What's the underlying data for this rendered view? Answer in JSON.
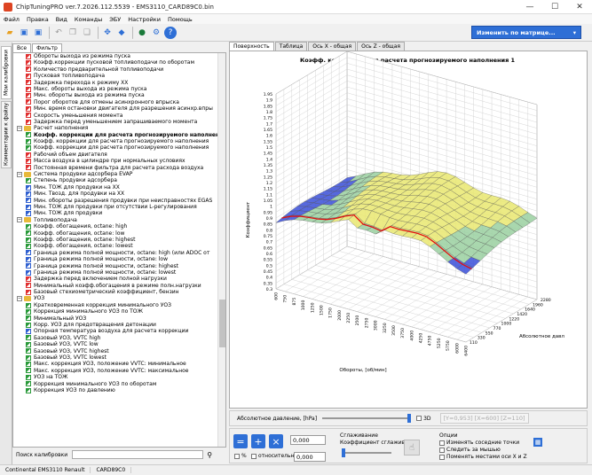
{
  "window": {
    "title": "ChipTuningPRO ver.7.2026.112.5539 - EMS3110_CARD89C0.bin",
    "minimize": "—",
    "maximize": "☐",
    "close": "✕"
  },
  "menu": [
    "Файл",
    "Правка",
    "Вид",
    "Команды",
    "ЭБУ",
    "Настройки",
    "Помощь"
  ],
  "toolbar": {
    "matrix_button": "Изменить по матрице...",
    "matrix_arrow": "▾"
  },
  "side_tabs": [
    "Мои калибровки",
    "Комментарии к файлу"
  ],
  "left_tabs": [
    "Все",
    "Фильтр"
  ],
  "tree": [
    {
      "level": 2,
      "label": "Обороты выхода из режима пуска",
      "icon": "red"
    },
    {
      "level": 2,
      "label": "Коэфф.коррекции пусковой топливоподачи по оборотам",
      "icon": "red"
    },
    {
      "level": 2,
      "label": "Количество предварительной топливоподачи",
      "icon": "red"
    },
    {
      "level": 2,
      "label": "Пусковая топливоподача",
      "icon": "red"
    },
    {
      "level": 2,
      "label": "Задержка перехода к режиму XX",
      "icon": "red"
    },
    {
      "level": 2,
      "label": "Макс. обороты выхода из режима пуска",
      "icon": "red"
    },
    {
      "level": 2,
      "label": "Мин. обороты выхода из режима пуска",
      "icon": "red"
    },
    {
      "level": 2,
      "label": "Порог оборотов для отмены асинхронного впрыска",
      "icon": "red"
    },
    {
      "level": 2,
      "label": "Мин. время остановки двигателя для разрешения асинхр.впры",
      "icon": "red"
    },
    {
      "level": 2,
      "label": "Скорость уменьшения момента",
      "icon": "red"
    },
    {
      "level": 2,
      "label": "Задержка перед уменьшением запрашиваемого момента",
      "icon": "red"
    },
    {
      "level": 1,
      "label": "Расчет наполнения",
      "folder": true,
      "exp": "−"
    },
    {
      "level": 2,
      "label": "Коэфф. коррекции для расчета прогнозируемого наполнения",
      "icon": "green",
      "bold": true
    },
    {
      "level": 2,
      "label": "Коэфф. коррекции для расчета прогнозируемого наполнения",
      "icon": "green"
    },
    {
      "level": 2,
      "label": "Коэфф. коррекции для расчета прогнозируемого наполнения",
      "icon": "green"
    },
    {
      "level": 2,
      "label": "Рабочий объем двигателя",
      "icon": "red"
    },
    {
      "level": 2,
      "label": "Масса воздуха в цилиндре при нормальных условиях",
      "icon": "red"
    },
    {
      "level": 2,
      "label": "Постоянная времени фильтра для расчета расхода воздуха",
      "icon": "red"
    },
    {
      "level": 1,
      "label": "Система продувки адсорбера EVAP",
      "folder": true,
      "exp": "−"
    },
    {
      "level": 2,
      "label": "Степень продувки адсорбера",
      "icon": "green"
    },
    {
      "level": 2,
      "label": "Мин. ТОЖ для продувки на XX",
      "icon": "blue"
    },
    {
      "level": 2,
      "label": "Мин. Твозд. для продувки на XX",
      "icon": "blue"
    },
    {
      "level": 2,
      "label": "Мин. обороты разрешения продувки при неисправностях EGAS",
      "icon": "blue"
    },
    {
      "level": 2,
      "label": "Мин. ТОЖ для продувки при отсутствии L-регулирования",
      "icon": "blue"
    },
    {
      "level": 2,
      "label": "Мин. ТОЖ для продувки",
      "icon": "blue"
    },
    {
      "level": 1,
      "label": "Топливоподача",
      "folder": true,
      "exp": "−"
    },
    {
      "level": 2,
      "label": "Коэфф. обогащения, octane: high",
      "icon": "green"
    },
    {
      "level": 2,
      "label": "Коэфф. обогащения, octane: low",
      "icon": "green"
    },
    {
      "level": 2,
      "label": "Коэфф. обогащения, octane: highest",
      "icon": "green"
    },
    {
      "level": 2,
      "label": "Коэфф. обогащения, octane: lowest",
      "icon": "green"
    },
    {
      "level": 2,
      "label": "Граница режима полной мощности, octane: high (или ADOC от",
      "icon": "blue"
    },
    {
      "level": 2,
      "label": "Граница режима полной мощности, octane: low",
      "icon": "blue"
    },
    {
      "level": 2,
      "label": "Граница режима полной мощности, octane: highest",
      "icon": "blue"
    },
    {
      "level": 2,
      "label": "Граница режима полной мощности, octane: lowest",
      "icon": "blue"
    },
    {
      "level": 2,
      "label": "Задержка перед включением полной нагрузки",
      "icon": "red"
    },
    {
      "level": 2,
      "label": "Минимальный коэфф.обогащения в режиме полн.нагрузки",
      "icon": "red"
    },
    {
      "level": 2,
      "label": "Базовый стехиометрический коэффициент, бензин",
      "icon": "red"
    },
    {
      "level": 1,
      "label": "УОЗ",
      "folder": true,
      "exp": "−"
    },
    {
      "level": 2,
      "label": "Кратковременная коррекция минимального УОЗ",
      "icon": "green"
    },
    {
      "level": 2,
      "label": "Коррекция минимального УОЗ по ТОЖ",
      "icon": "green"
    },
    {
      "level": 2,
      "label": "Минимальный УОЗ",
      "icon": "green"
    },
    {
      "level": 2,
      "label": "Корр. УОЗ для предотвращения детонации",
      "icon": "green"
    },
    {
      "level": 2,
      "label": "Опорная температура воздуха для расчета коррекции",
      "icon": "blue"
    },
    {
      "level": 2,
      "label": "Базовый УОЗ, VVTC high",
      "icon": "green"
    },
    {
      "level": 2,
      "label": "Базовый УОЗ, VVTC low",
      "icon": "green"
    },
    {
      "level": 2,
      "label": "Базовый УОЗ, VVTC highest",
      "icon": "green"
    },
    {
      "level": 2,
      "label": "Базовый УОЗ, VVTC lowest",
      "icon": "green"
    },
    {
      "level": 2,
      "label": "Макс. коррекция УОЗ, положение VVTC: минимальное",
      "icon": "green"
    },
    {
      "level": 2,
      "label": "Макс. коррекция УОЗ, положение VVTC: максимальное",
      "icon": "green"
    },
    {
      "level": 2,
      "label": "УОЗ на ТОЖ",
      "icon": "green"
    },
    {
      "level": 2,
      "label": "Коррекция минимального УОЗ по оборотам",
      "icon": "green"
    },
    {
      "level": 2,
      "label": "Коррекция УОЗ по давлению",
      "icon": "green"
    }
  ],
  "search": {
    "label": "Поиск калибровки",
    "icon": "binoculars-icon"
  },
  "right_tabs": [
    "Поверхность",
    "Таблица",
    "Ось X - общая",
    "Ось Z - общая"
  ],
  "chart_data": {
    "type": "surface3d",
    "title": "Коэфф. коррекции для расчета прогнозируемого наполнения 1",
    "xlabel": "Обороты, [об/мин]",
    "ylabel": "Коэффициент",
    "zlabel": "Абсолютное давл",
    "x_ticks": [
      "600",
      "750",
      "875",
      "1000",
      "1250",
      "1500",
      "1750",
      "2000",
      "2250",
      "2500",
      "2750",
      "3000",
      "3250",
      "3500",
      "3750",
      "4000",
      "4250",
      "4750",
      "5250",
      "5750",
      "6000",
      "6400"
    ],
    "z_ticks": [
      "110",
      "330",
      "550",
      "770",
      "1000",
      "1220",
      "1420",
      "1640",
      "1960",
      "2280"
    ],
    "y_ticks": [
      "0.3",
      "0.35",
      "0.4",
      "0.45",
      "0.5",
      "0.55",
      "0.6",
      "0.65",
      "0.7",
      "0.75",
      "0.8",
      "0.85",
      "0.9",
      "0.95",
      "1",
      "1.05",
      "1.1",
      "1.15",
      "1.2",
      "1.25",
      "1.3",
      "1.35",
      "1.4",
      "1.45",
      "1.5",
      "1.55",
      "1.6",
      "1.65",
      "1.7",
      "1.75",
      "1.8",
      "1.85",
      "1.9",
      "1.95"
    ],
    "ylim": [
      0.3,
      1.95
    ]
  },
  "pressure": {
    "label": "Абсолютное давление, [hPa]",
    "check3d": "3D",
    "coords": "[Y=0,953] [X=600] [Z=110]"
  },
  "edit": {
    "value1": "0,000",
    "pct": "%",
    "relative": "относительно",
    "value2": "0,000",
    "smoothing": "Сглаживание",
    "smooth_coef": "Коэффициент сглаживания"
  },
  "options": {
    "title": "Опции",
    "o1": "Изменять соседние точки",
    "o2": "Следить за мышью",
    "o3": "Поменять местами оси X и Z"
  },
  "status": {
    "ecu": "Continental EMS3110 Renault",
    "card": "CARD89C0"
  }
}
